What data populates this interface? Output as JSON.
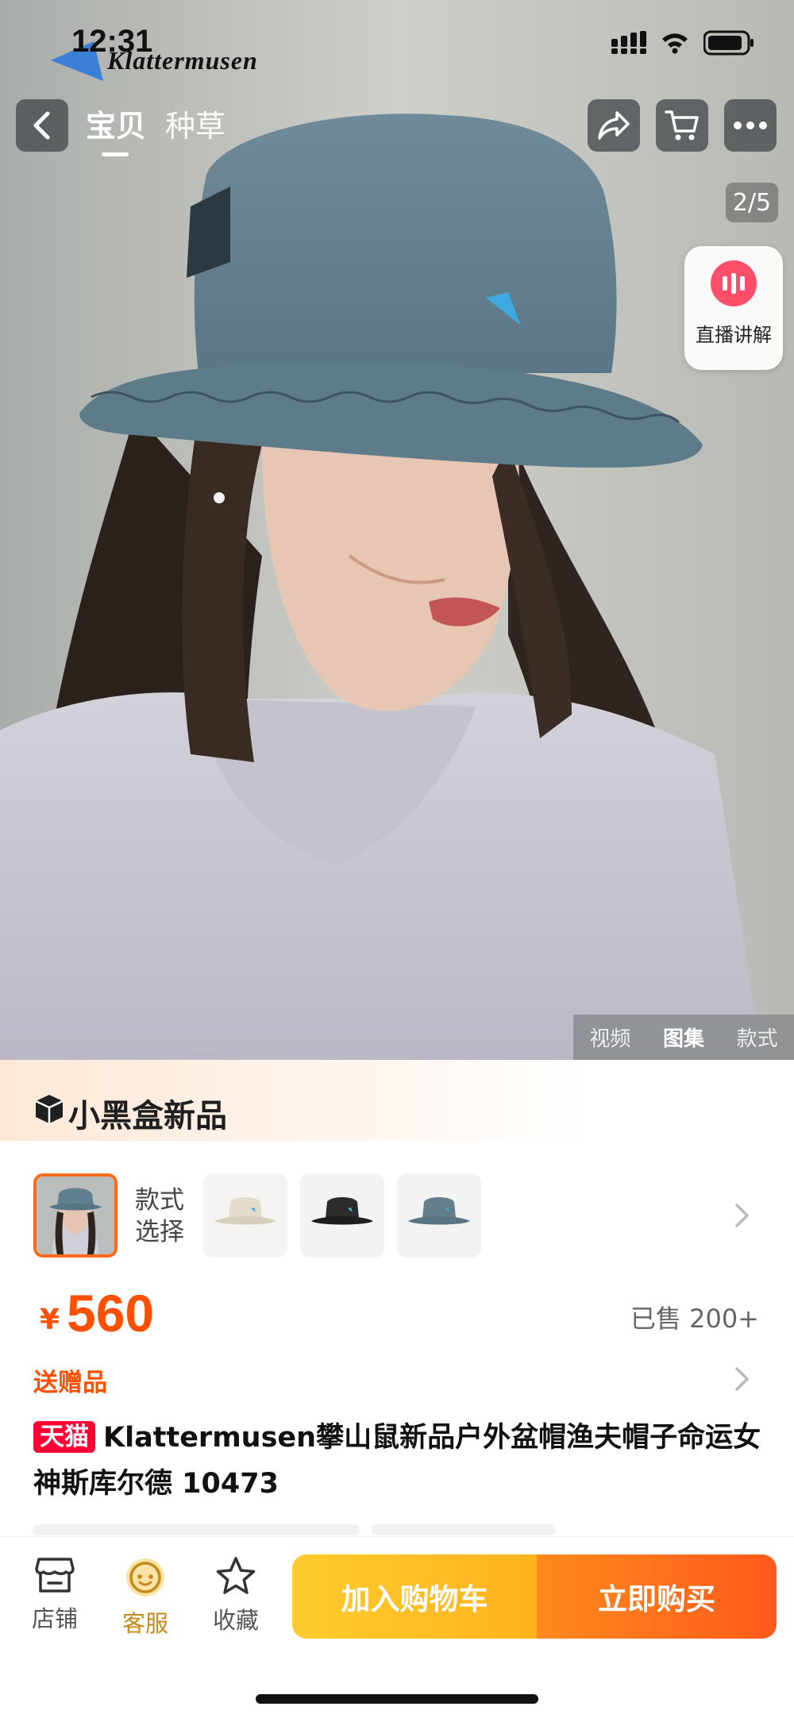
{
  "status_bar": {
    "time": "12:31"
  },
  "brand": {
    "logo_text": "Klattermusen"
  },
  "nav": {
    "tabs": [
      "宝贝",
      "种草"
    ]
  },
  "gallery": {
    "counter": "2/5",
    "media_tabs": [
      "视频",
      "图集",
      "款式"
    ],
    "active_media_tab": "图集"
  },
  "live": {
    "label": "直播讲解"
  },
  "new_banner": {
    "text": "小黑盒新品"
  },
  "variants": {
    "label_line1": "款式",
    "label_line2": "选择"
  },
  "price": {
    "currency": "¥",
    "amount": "560",
    "sold": "已售 200+"
  },
  "gift": {
    "label": "送赠品"
  },
  "product": {
    "badge": "天猫",
    "title": "Klattermusen攀山鼠新品户外盆帽渔夫帽子命运女神斯库尔德 10473"
  },
  "bottom_bar": {
    "shop": "店铺",
    "service": "客服",
    "favorite": "收藏",
    "add_to_cart": "加入购物车",
    "buy_now": "立即购买"
  },
  "colors": {
    "accent": "#ff5000",
    "cart": "#ffb31e",
    "buy": "#ff5a1a",
    "tmall": "#ff0036"
  }
}
